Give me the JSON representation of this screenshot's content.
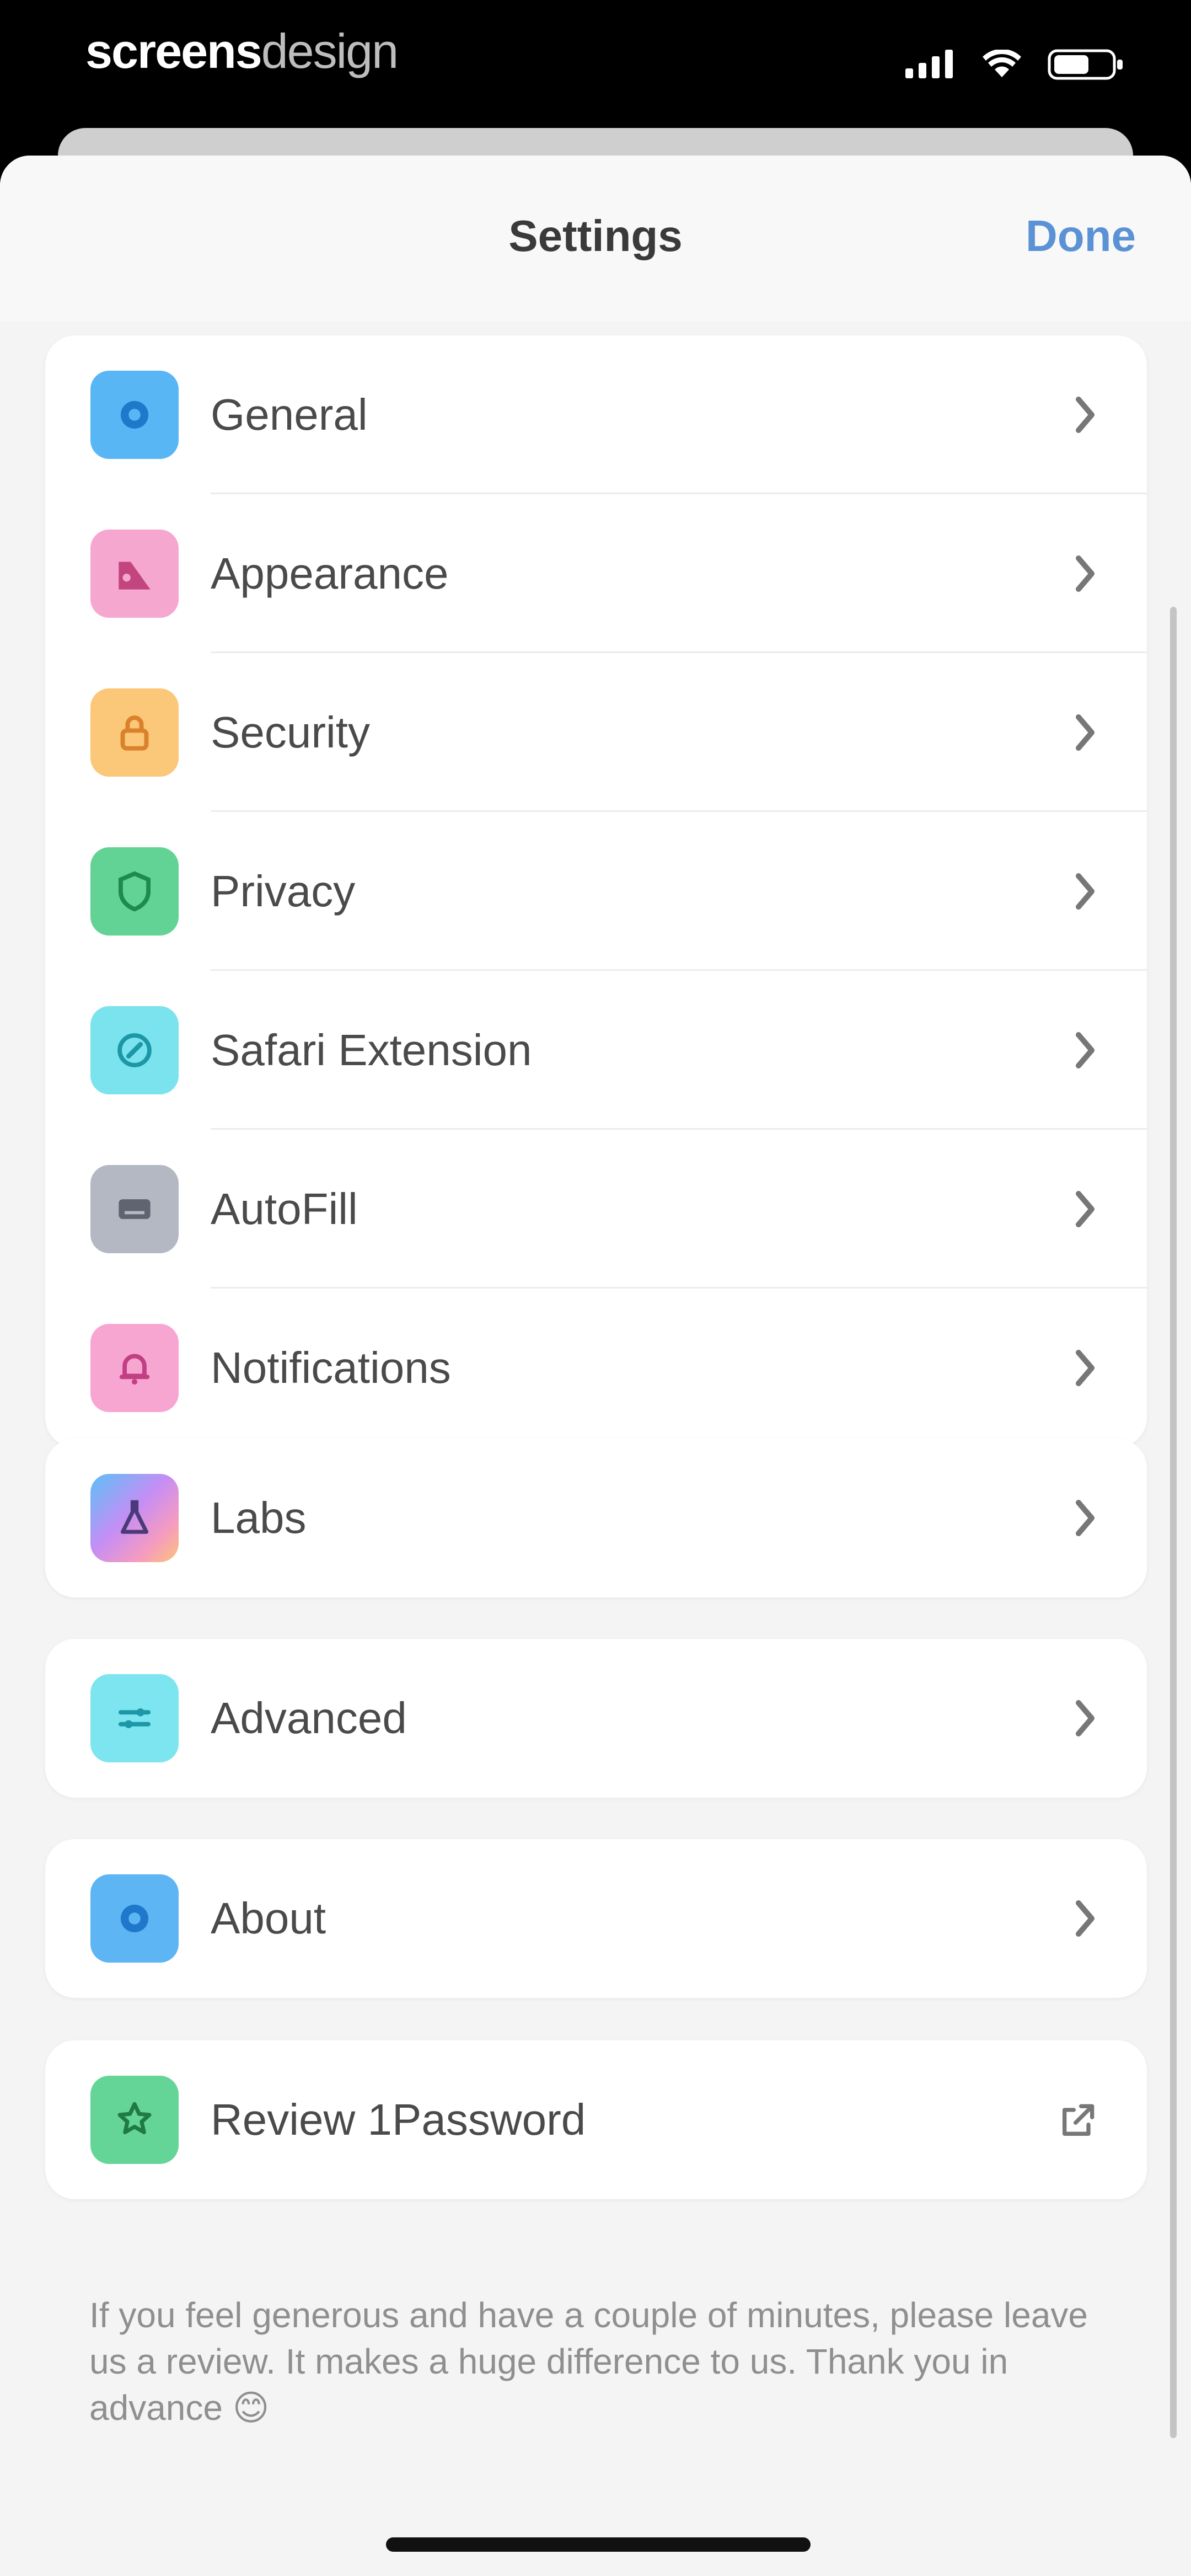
{
  "status_bar": {
    "brand_bold": "screens",
    "brand_light": "design"
  },
  "navbar": {
    "title": "Settings",
    "done_label": "Done"
  },
  "groups": [
    [
      {
        "label": "General",
        "icon": "gear-icon",
        "color": "#58b6f5"
      },
      {
        "label": "Appearance",
        "icon": "palette-icon",
        "color": "#f6a7cf"
      },
      {
        "label": "Security",
        "icon": "lock-icon",
        "color": "#fbc778"
      },
      {
        "label": "Privacy",
        "icon": "shield-icon",
        "color": "#62d394"
      },
      {
        "label": "Safari Extension",
        "icon": "compass-icon",
        "color": "#7be3ee"
      },
      {
        "label": "AutoFill",
        "icon": "keyboard-icon",
        "color": "#b4b8c3"
      },
      {
        "label": "Notifications",
        "icon": "bell-icon",
        "color": "#f7a6d2"
      }
    ],
    [
      {
        "label": "Labs",
        "icon": "flask-icon",
        "color": "#f59bc0"
      }
    ],
    [
      {
        "label": "Advanced",
        "icon": "sliders-icon",
        "color": "#7de5f0"
      }
    ],
    [
      {
        "label": "About",
        "icon": "info-icon",
        "color": "#5db5f4"
      }
    ],
    [
      {
        "label": "Review 1Password",
        "icon": "star-icon",
        "color": "#65d597"
      }
    ]
  ],
  "footer": "If you feel generous and have a couple of minutes, please leave us a review. It makes a huge difference to us. Thank you in advance 😊"
}
